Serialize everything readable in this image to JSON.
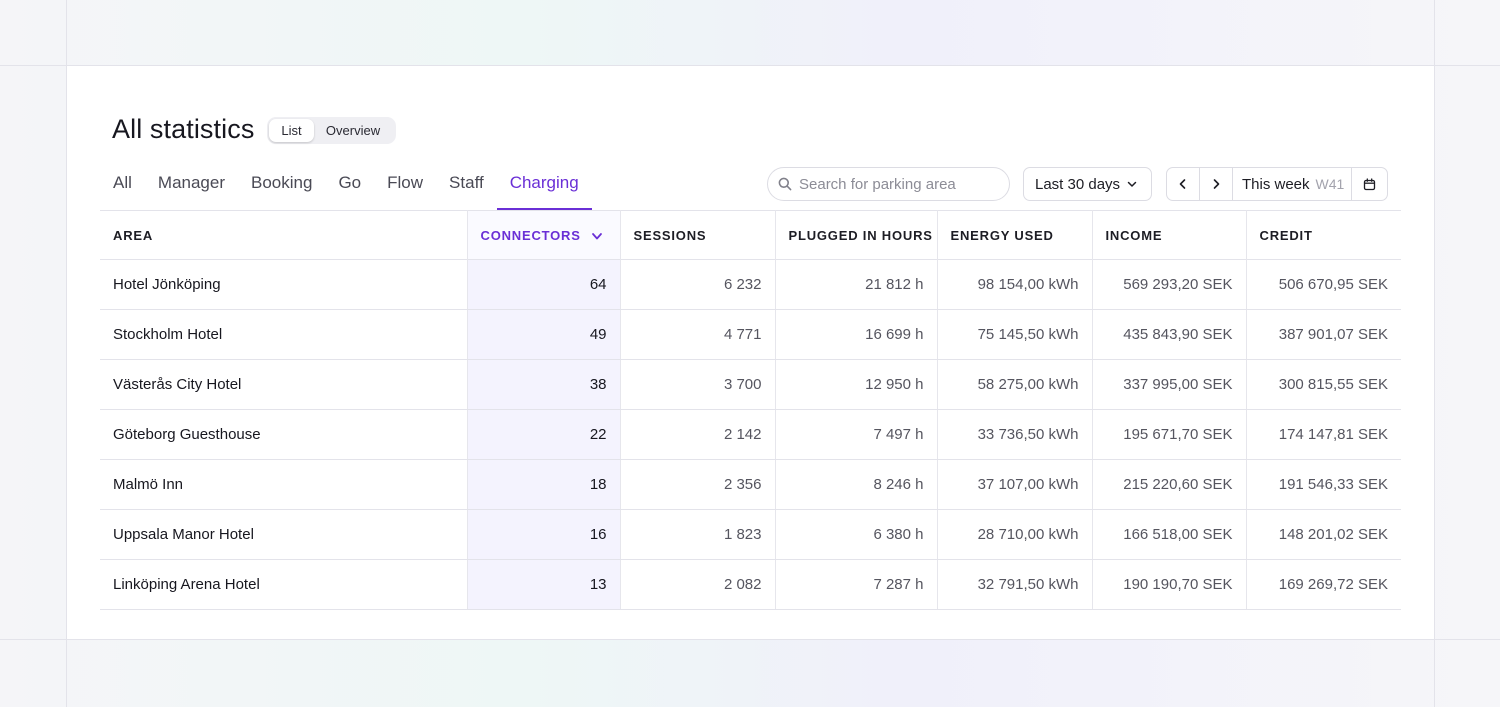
{
  "page": {
    "title": "All statistics",
    "view_toggle": {
      "list": "List",
      "overview": "Overview",
      "selected": "List"
    }
  },
  "tabs": [
    {
      "label": "All"
    },
    {
      "label": "Manager"
    },
    {
      "label": "Booking"
    },
    {
      "label": "Go"
    },
    {
      "label": "Flow"
    },
    {
      "label": "Staff"
    },
    {
      "label": "Charging",
      "active": true
    }
  ],
  "search": {
    "placeholder": "Search for parking area",
    "value": ""
  },
  "date_range": {
    "label": "Last 30 days"
  },
  "week_picker": {
    "label": "This week",
    "week": "W41"
  },
  "table": {
    "columns": [
      "AREA",
      "CONNECTORS",
      "SESSIONS",
      "PLUGGED IN HOURS",
      "ENERGY USED",
      "INCOME",
      "CREDIT"
    ],
    "sorted_column": "CONNECTORS",
    "rows": [
      [
        "Hotel Jönköping",
        "64",
        "6 232",
        "21 812 h",
        "98 154,00 kWh",
        "569 293,20 SEK",
        "506 670,95 SEK"
      ],
      [
        "Stockholm Hotel",
        "49",
        "4 771",
        "16 699 h",
        "75 145,50 kWh",
        "435 843,90 SEK",
        "387 901,07 SEK"
      ],
      [
        "Västerås City Hotel",
        "38",
        "3 700",
        "12 950 h",
        "58 275,00 kWh",
        "337 995,00 SEK",
        "300 815,55 SEK"
      ],
      [
        "Göteborg Guesthouse",
        "22",
        "2 142",
        "7 497 h",
        "33 736,50 kWh",
        "195 671,70 SEK",
        "174 147,81 SEK"
      ],
      [
        "Malmö Inn",
        "18",
        "2 356",
        "8 246 h",
        "37 107,00 kWh",
        "215 220,60 SEK",
        "191 546,33 SEK"
      ],
      [
        "Uppsala Manor Hotel",
        "16",
        "1 823",
        "6 380 h",
        "28 710,00 kWh",
        "166 518,00 SEK",
        "148 201,02 SEK"
      ],
      [
        "Linköping Arena Hotel",
        "13",
        "2 082",
        "7 287 h",
        "32 791,50 kWh",
        "190 190,70 SEK",
        "169 269,72 SEK"
      ]
    ]
  },
  "icons": {
    "search": "search-icon",
    "dropdown": "chevron-down-icon",
    "prev": "chevron-left-icon",
    "next": "chevron-right-icon",
    "calendar": "calendar-icon",
    "sort": "sort-desc-icon"
  },
  "colors": {
    "accent": "#6a2fd6",
    "sorted_column_bg": "#f4f3fe"
  }
}
